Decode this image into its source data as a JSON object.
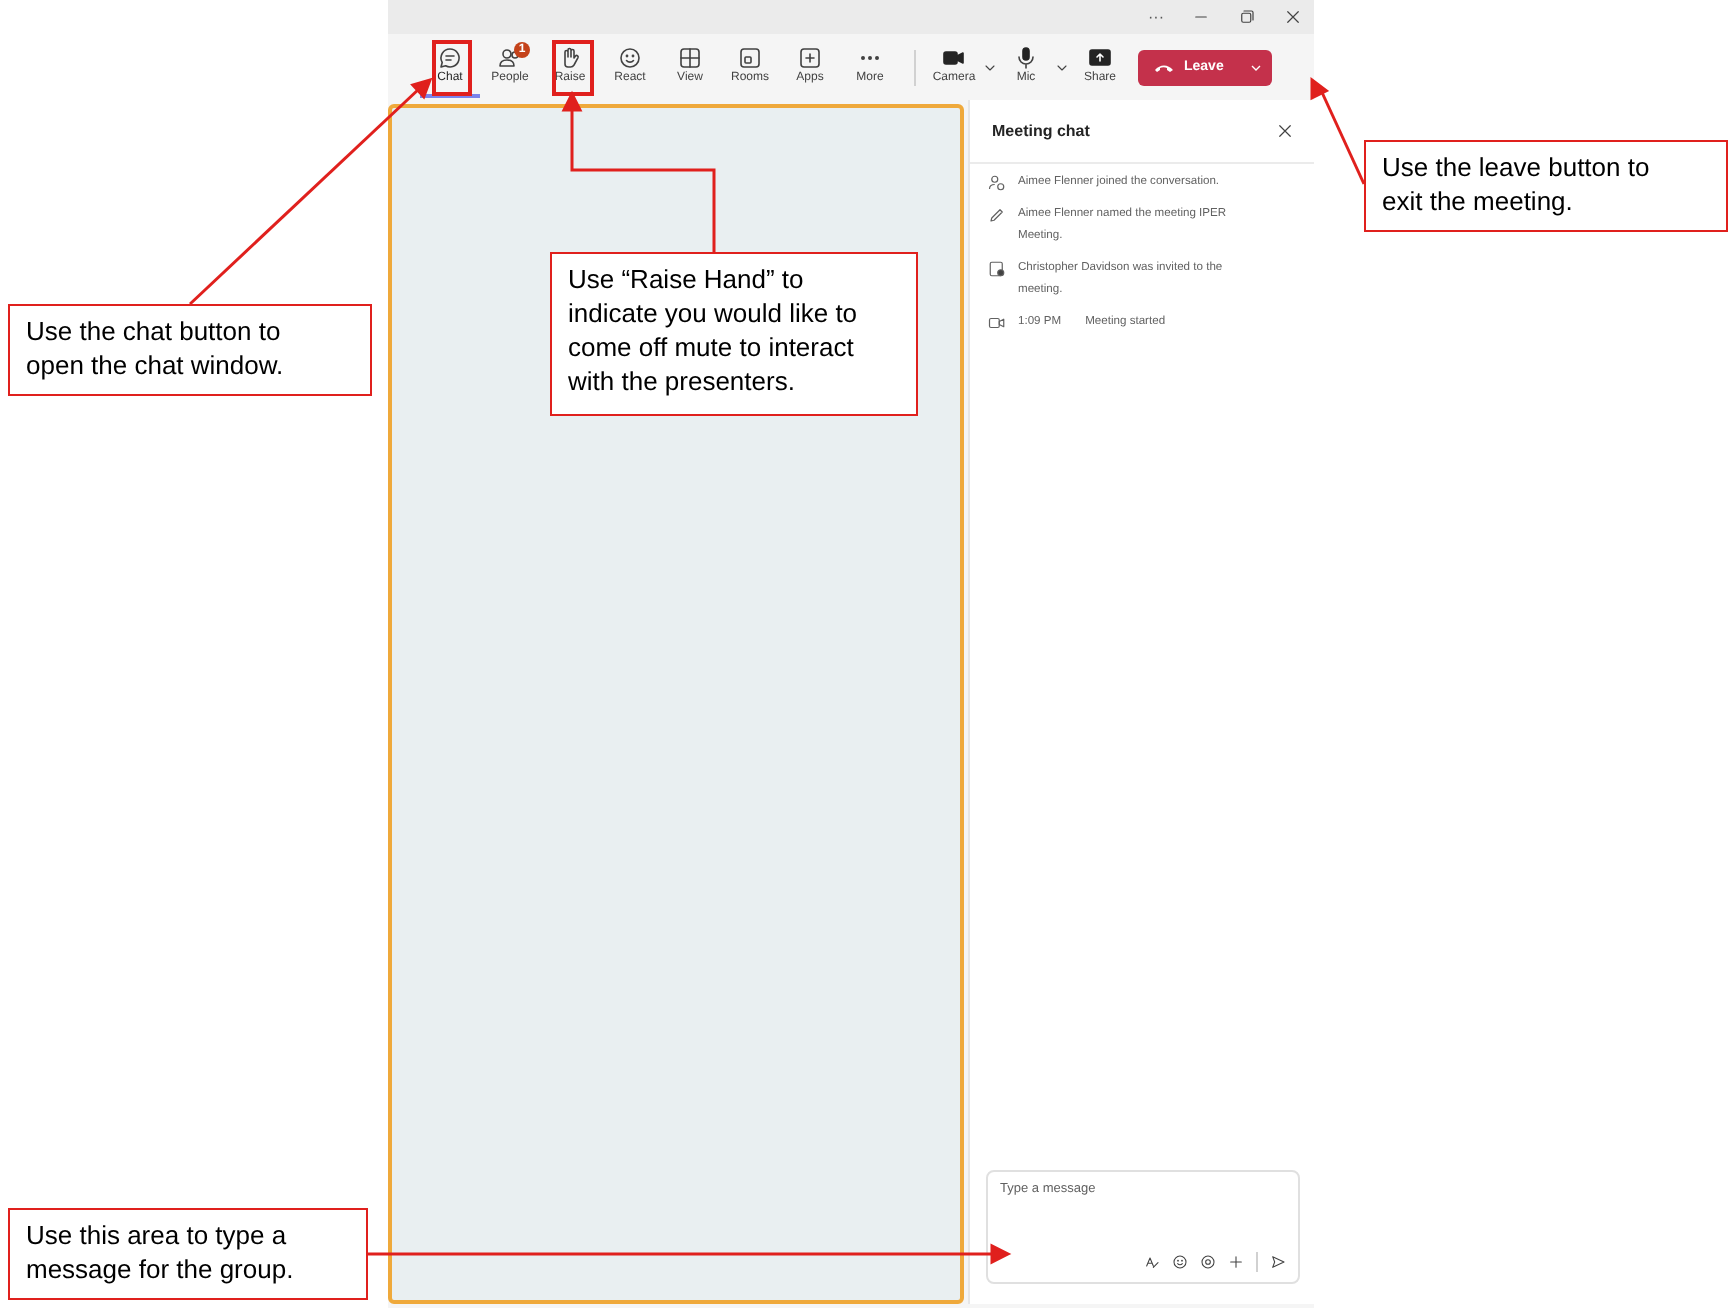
{
  "window": {
    "title_bar": {
      "more": "···"
    }
  },
  "toolbar": {
    "items": [
      {
        "label": "Chat",
        "selected": true
      },
      {
        "label": "People",
        "selected": false,
        "badge": "1"
      },
      {
        "label": "Raise",
        "selected": false
      },
      {
        "label": "React",
        "selected": false
      },
      {
        "label": "View",
        "selected": false
      },
      {
        "label": "Rooms",
        "selected": false
      },
      {
        "label": "Apps",
        "selected": false
      },
      {
        "label": "More",
        "selected": false
      }
    ],
    "devices": [
      {
        "label": "Camera"
      },
      {
        "label": "Mic"
      }
    ],
    "share": {
      "label": "Share"
    },
    "leave": {
      "label": "Leave"
    }
  },
  "chat": {
    "title": "Meeting chat",
    "events": [
      {
        "text": "Aimee Flenner joined the conversation."
      },
      {
        "text": "Aimee Flenner named the meeting IPER Meeting."
      },
      {
        "text": "Christopher Davidson was invited to the meeting."
      },
      {
        "time": "1:09 PM",
        "text": "Meeting started"
      }
    ],
    "composer": {
      "placeholder": "Type a message"
    }
  },
  "callouts": [
    {
      "text": "Use the chat button to open the chat window."
    },
    {
      "text": "Use “Raise Hand” to indicate you would like to come off mute to interact with the presenters."
    },
    {
      "text": "Use the leave button to exit the meeting."
    },
    {
      "text": "Use this area to type a message for the group."
    }
  ]
}
